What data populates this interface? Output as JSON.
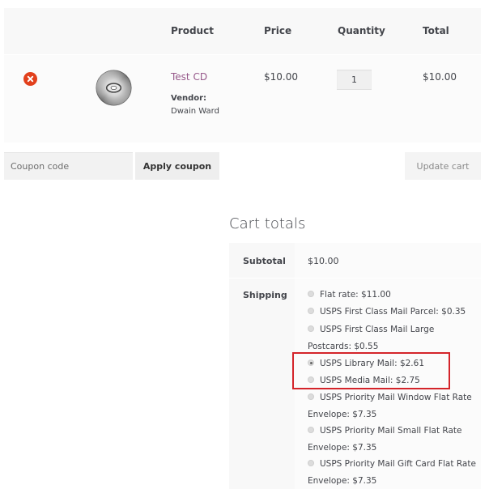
{
  "cart": {
    "headers": {
      "product": "Product",
      "price": "Price",
      "quantity": "Quantity",
      "total": "Total"
    },
    "item": {
      "name": "Test CD",
      "vendor_label": "Vendor:",
      "vendor_name": "Dwain Ward",
      "price": "$10.00",
      "quantity": "1",
      "total": "$10.00",
      "thumbnail_icon": "cd-disc-icon",
      "remove_icon": "remove-x-icon"
    }
  },
  "actions": {
    "coupon_placeholder": "Coupon code",
    "apply_coupon_label": "Apply coupon",
    "update_cart_label": "Update cart"
  },
  "totals": {
    "title": "Cart totals",
    "subtotal_label": "Subtotal",
    "subtotal_value": "$10.00",
    "shipping_label": "Shipping",
    "shipping_options": [
      {
        "label": "Flat rate: $11.00",
        "checked": false
      },
      {
        "label": "USPS First Class Mail Parcel: $0.35",
        "checked": false
      },
      {
        "label": "USPS First Class Mail Large",
        "label_cont": "Postcards: $0.55",
        "checked": false
      },
      {
        "label": "USPS Library Mail: $2.61",
        "checked": true
      },
      {
        "label": "USPS Media Mail: $2.75",
        "checked": false
      },
      {
        "label": "USPS Priority Mail Window Flat Rate",
        "label_cont": "Envelope: $7.35",
        "checked": false
      },
      {
        "label": "USPS Priority Mail Small Flat Rate",
        "label_cont": "Envelope: $7.35",
        "checked": false
      },
      {
        "label": "USPS Priority Mail Gift Card Flat Rate",
        "label_cont": "Envelope: $7.35",
        "checked": false
      }
    ]
  },
  "colors": {
    "accent_link": "#96588a",
    "remove": "#e2401c",
    "highlight": "#d4242a"
  }
}
